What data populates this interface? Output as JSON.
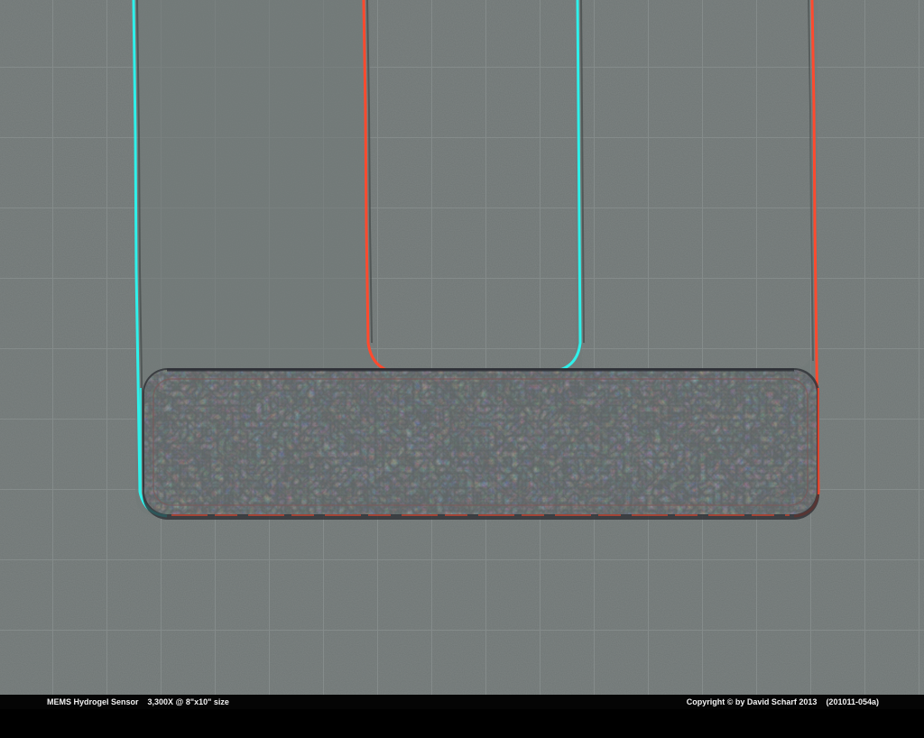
{
  "image": {
    "subject": "mems-hydrogel-sensor",
    "style": "anaglyph-3d-sem",
    "colors": {
      "background": "#6f7675",
      "grid_line": "#858c8b",
      "pad_fill": "#5f6666",
      "red_channel": "#ff4a2e",
      "cyan_channel": "#2ff0ea"
    }
  },
  "caption": {
    "left_text": "MEMS Hydrogel Sensor    3,300X @ 8\"x10\" size",
    "right_text": "Copyright © by David Scharf 2013    (201011-054a)"
  }
}
